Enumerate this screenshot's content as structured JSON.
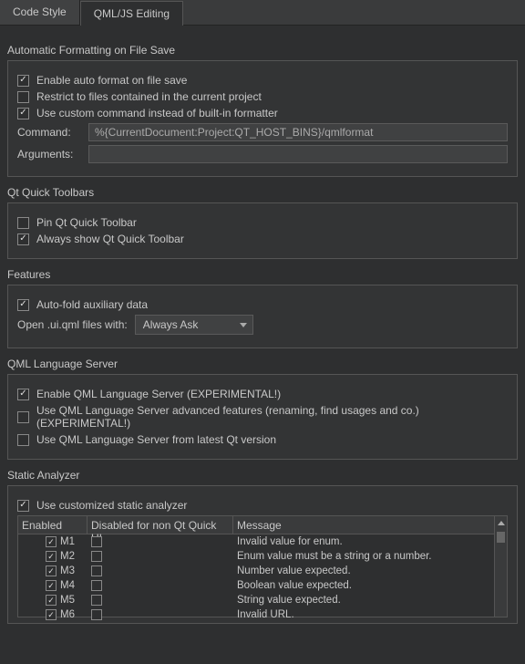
{
  "tabs": [
    {
      "label": "Code Style",
      "active": false
    },
    {
      "label": "QML/JS Editing",
      "active": true
    }
  ],
  "groups": {
    "auto_format": {
      "title": "Automatic Formatting on File Save",
      "enable_label": "Enable auto format on file save",
      "enable_checked": true,
      "restrict_label": "Restrict to files contained in the current project",
      "restrict_checked": false,
      "custom_label": "Use custom command instead of built-in formatter",
      "custom_checked": true,
      "command_field_label": "Command:",
      "command_value": "%{CurrentDocument:Project:QT_HOST_BINS}/qmlformat",
      "arguments_field_label": "Arguments:",
      "arguments_value": ""
    },
    "qt_quick": {
      "title": "Qt Quick Toolbars",
      "pin_label": "Pin Qt Quick Toolbar",
      "pin_checked": false,
      "always_label": "Always show Qt Quick Toolbar",
      "always_checked": true
    },
    "features": {
      "title": "Features",
      "autofold_label": "Auto-fold auxiliary data",
      "autofold_checked": true,
      "open_label": "Open .ui.qml files with:",
      "open_value": "Always Ask"
    },
    "qmlls": {
      "title": "QML Language Server",
      "enable_label": "Enable QML Language Server (EXPERIMENTAL!)",
      "enable_checked": true,
      "advanced_label": "Use QML Language Server advanced features (renaming, find usages and co.) (EXPERIMENTAL!)",
      "advanced_checked": false,
      "latest_label": "Use QML Language Server from latest Qt version",
      "latest_checked": false
    },
    "analyzer": {
      "title": "Static Analyzer",
      "custom_label": "Use customized static analyzer",
      "custom_checked": true,
      "headers": {
        "enabled": "Enabled",
        "disabled": "Disabled for non Qt Quick UI",
        "message": "Message"
      },
      "rows": [
        {
          "id": "M1",
          "enabled": true,
          "disabled": false,
          "message": "Invalid value for enum."
        },
        {
          "id": "M2",
          "enabled": true,
          "disabled": false,
          "message": "Enum value must be a string or a number."
        },
        {
          "id": "M3",
          "enabled": true,
          "disabled": false,
          "message": "Number value expected."
        },
        {
          "id": "M4",
          "enabled": true,
          "disabled": false,
          "message": "Boolean value expected."
        },
        {
          "id": "M5",
          "enabled": true,
          "disabled": false,
          "message": "String value expected."
        },
        {
          "id": "M6",
          "enabled": true,
          "disabled": false,
          "message": "Invalid URL."
        }
      ]
    }
  }
}
